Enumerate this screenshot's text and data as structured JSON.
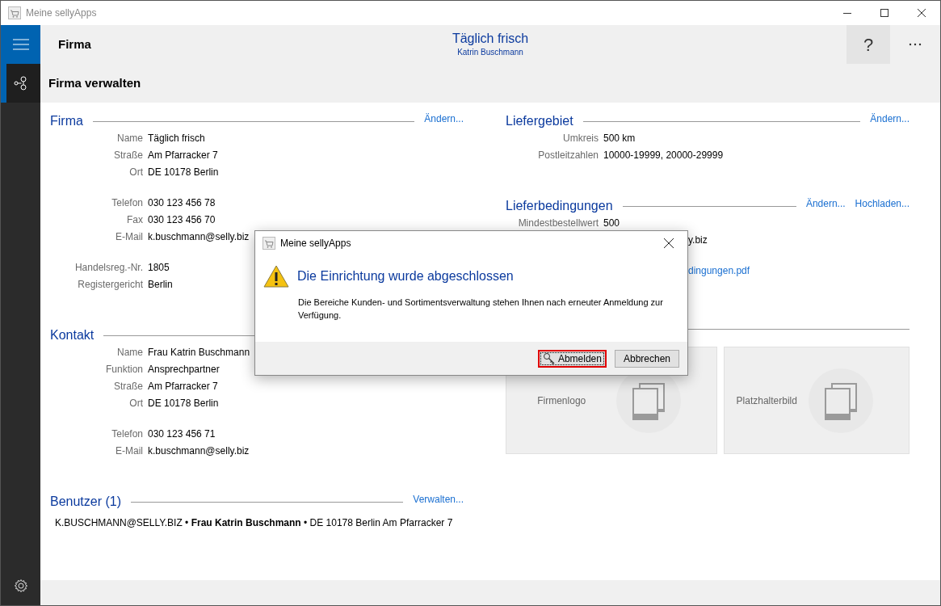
{
  "window": {
    "title": "Meine sellyApps"
  },
  "header": {
    "page_title": "Firma",
    "company": "Täglich frisch",
    "user": "Katrin Buschmann",
    "help": "?"
  },
  "sidebar_items": [
    {
      "kind": "network",
      "selected": true
    }
  ],
  "subheader": "Firma verwalten",
  "left_sections": [
    {
      "title": "Firma",
      "actions": [
        "Ändern..."
      ],
      "groups": [
        [
          {
            "label": "Name",
            "value": "Täglich frisch"
          },
          {
            "label": "Straße",
            "value": "Am Pfarracker 7"
          },
          {
            "label": "Ort",
            "value": "DE 10178 Berlin"
          }
        ],
        [
          {
            "label": "Telefon",
            "value": "030 123 456 78"
          },
          {
            "label": "Fax",
            "value": "030 123 456 70"
          },
          {
            "label": "E-Mail",
            "value": "k.buschmann@selly.biz"
          }
        ],
        [
          {
            "label": "Handelsreg.-Nr.",
            "value": "1805"
          },
          {
            "label": "Registergericht",
            "value": "Berlin"
          }
        ]
      ]
    },
    {
      "title": "Kontakt",
      "groups": [
        [
          {
            "label": "Name",
            "value": "Frau Katrin Buschmann"
          },
          {
            "label": "Funktion",
            "value": "Ansprechpartner"
          },
          {
            "label": "Straße",
            "value": "Am Pfarracker 7"
          },
          {
            "label": "Ort",
            "value": "DE 10178 Berlin"
          }
        ],
        [
          {
            "label": "Telefon",
            "value": "030 123 456 71"
          },
          {
            "label": "E-Mail",
            "value": "k.buschmann@selly.biz"
          }
        ]
      ]
    },
    {
      "title": "Benutzer (1)",
      "actions": [
        "Verwalten..."
      ],
      "entries": [
        "K.BUSCHMANN@SELLY.BIZ • **Frau Katrin Buschmann** • DE 10178 Berlin Am Pfarracker 7"
      ]
    }
  ],
  "right_sections": [
    {
      "title": "Liefergebiet",
      "actions": [
        "Ändern..."
      ],
      "groups": [
        [
          {
            "label": "Umkreis",
            "value": "500 km"
          },
          {
            "label": "Postleitzahlen",
            "value": "10000-19999, 20000-29999"
          }
        ]
      ]
    },
    {
      "title": "Lieferbedingungen",
      "actions": [
        "Ändern...",
        "Hochladen..."
      ],
      "groups": [
        [
          {
            "label": "Mindestbestellwert",
            "value": "500"
          },
          {
            "value": "y.biz",
            "partial": true
          }
        ],
        [
          {
            "value": "dingungen.pdf",
            "partial": true,
            "kind": "link"
          }
        ]
      ]
    }
  ],
  "image_cards": [
    {
      "label": "Firmenlogo"
    },
    {
      "label": "Platzhalterbild"
    }
  ],
  "dialog": {
    "title": "Meine sellyApps",
    "heading": "Die Einrichtung wurde abgeschlossen",
    "message": "Die Bereiche Kunden- und Sortimentsverwaltung stehen Ihnen nach erneuter Anmeldung zur Verfügung.",
    "buttons": [
      {
        "label": "Abmelden",
        "kind": "key",
        "focused": true
      },
      {
        "label": "Abbrechen",
        "kind": "plain",
        "focused": false
      }
    ]
  }
}
